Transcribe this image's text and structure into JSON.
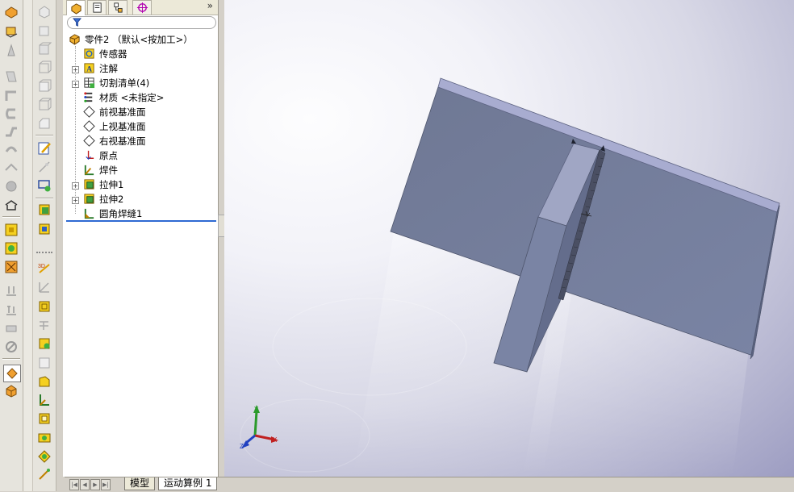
{
  "feature_tree": {
    "root_label": "零件2 （默认<按加工>）",
    "items": [
      {
        "label": "传感器"
      },
      {
        "label": "注解"
      },
      {
        "label": "切割清单(4)"
      },
      {
        "label": "材质 <未指定>"
      },
      {
        "label": "前视基准面"
      },
      {
        "label": "上视基准面"
      },
      {
        "label": "右视基准面"
      },
      {
        "label": "原点"
      },
      {
        "label": "焊件"
      },
      {
        "label": "拉伸1"
      },
      {
        "label": "拉伸2"
      },
      {
        "label": "圆角焊缝1"
      }
    ],
    "more_label": "»"
  },
  "bottom_tabs": {
    "model": "模型",
    "motion_study": "运动算例 1"
  },
  "triad": {
    "x_label": "X",
    "y_label": "Y",
    "z_label": "Z"
  },
  "colors": {
    "part_face": "#76809c",
    "part_top": "#a8acd0",
    "selection_line": "#2e6ad3"
  }
}
